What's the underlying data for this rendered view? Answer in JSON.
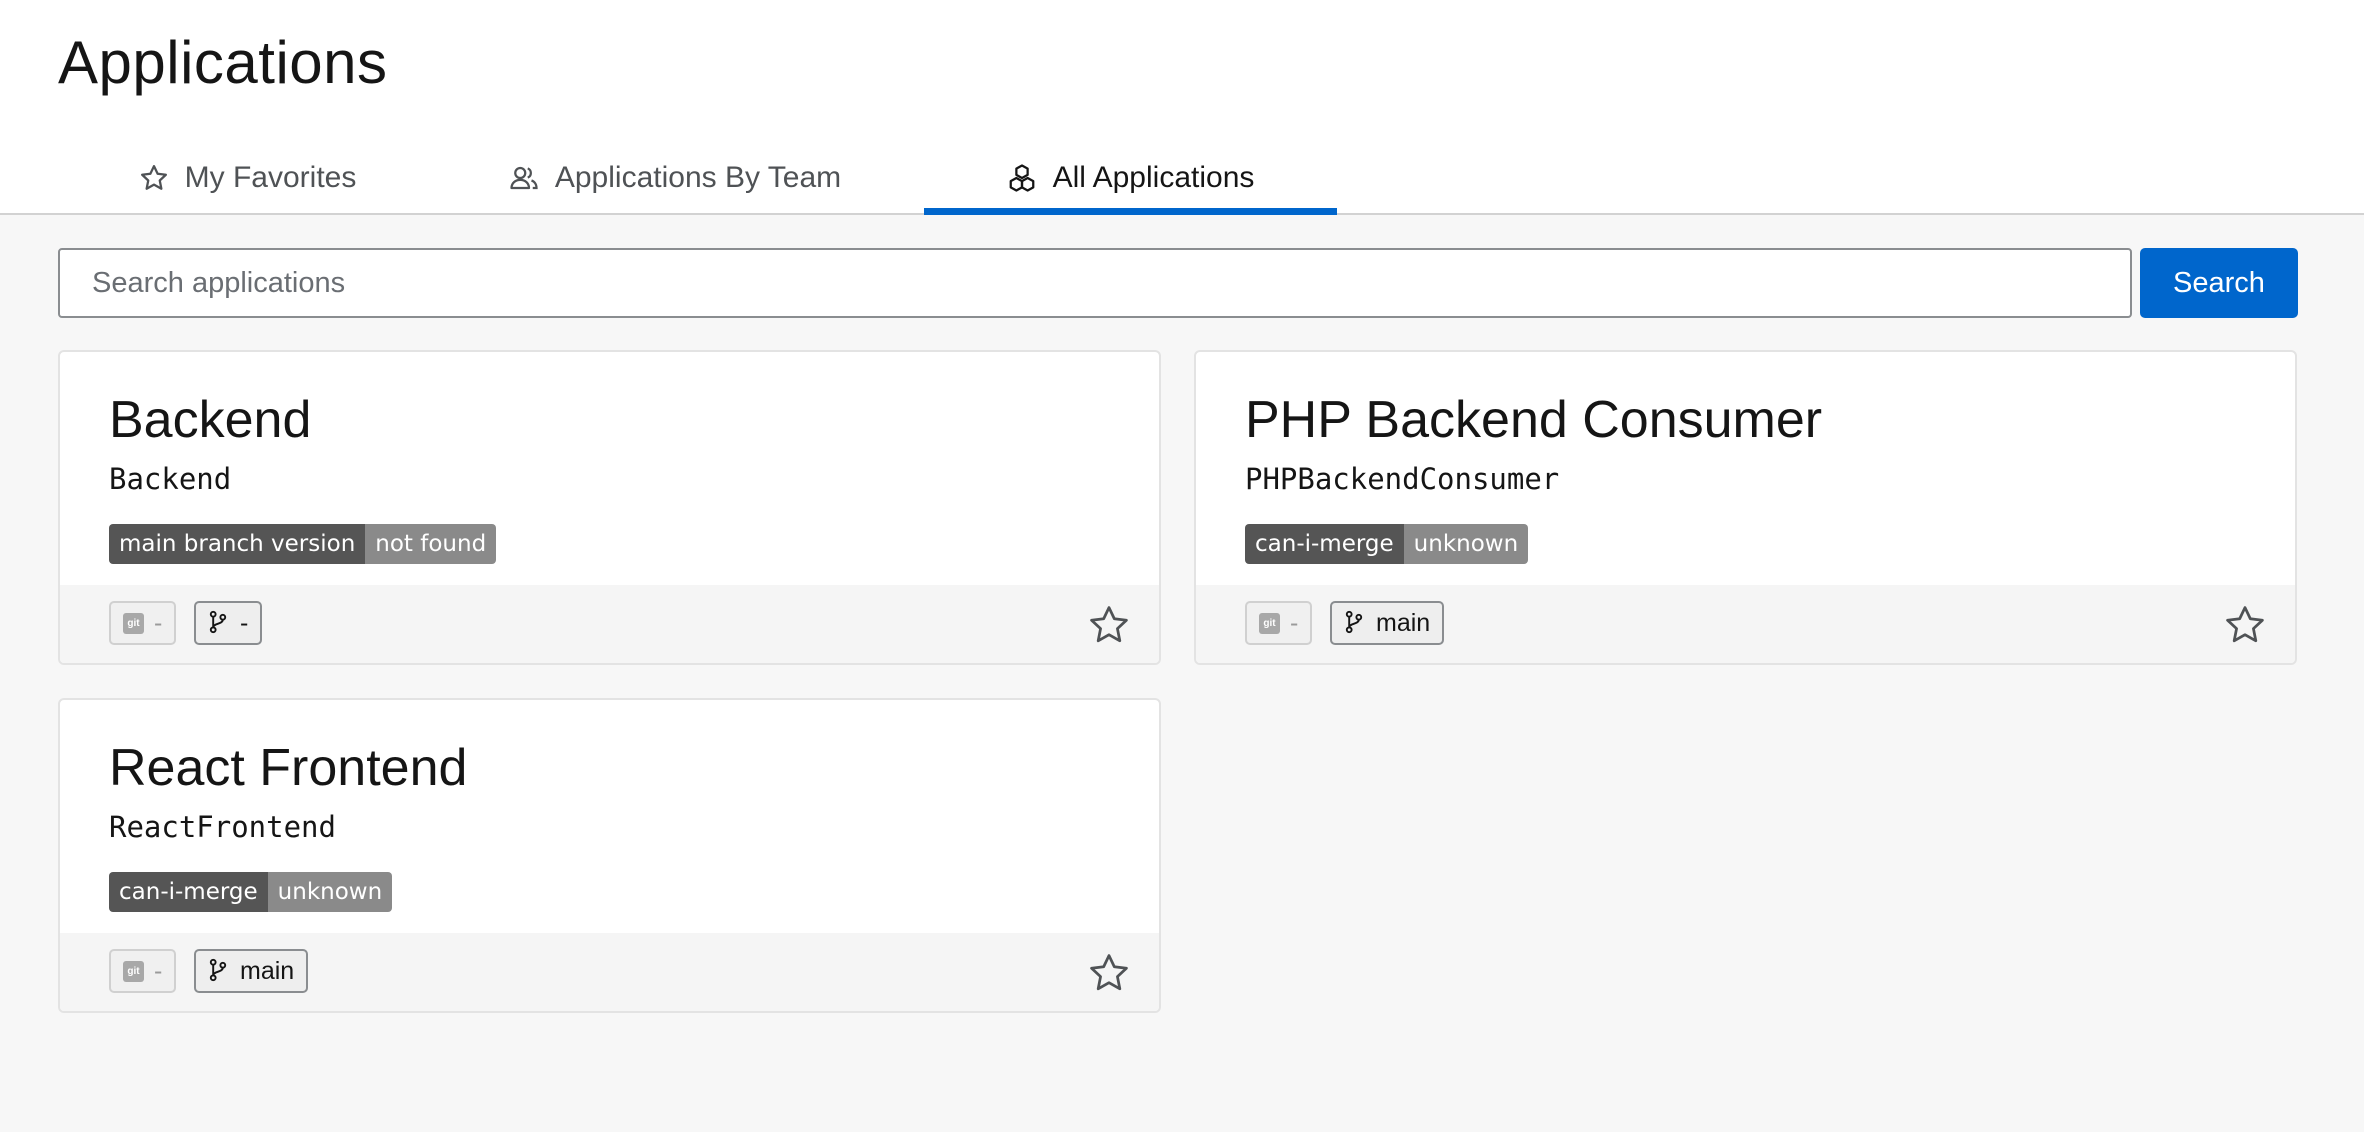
{
  "page": {
    "title": "Applications"
  },
  "tabs": [
    {
      "label": "My Favorites",
      "icon": "star-outline-icon"
    },
    {
      "label": "Applications By Team",
      "icon": "users-icon"
    },
    {
      "label": "All Applications",
      "icon": "cubes-icon",
      "active": true
    }
  ],
  "search": {
    "placeholder": "Search applications",
    "value": "",
    "button_label": "Search"
  },
  "colors": {
    "accent": "#0066cc",
    "badge_label": "#555555",
    "badge_value": "#8a8a8a"
  },
  "applications": [
    {
      "name": "Backend",
      "id": "Backend",
      "badge": {
        "label": "main branch version",
        "value": "not found"
      },
      "git_label": "git",
      "git_value": "-",
      "branch": "-",
      "favorite": false
    },
    {
      "name": "PHP Backend Consumer",
      "id": "PHPBackendConsumer",
      "badge": {
        "label": "can-i-merge",
        "value": "unknown"
      },
      "git_label": "git",
      "git_value": "-",
      "branch": "main",
      "favorite": false
    },
    {
      "name": "React Frontend",
      "id": "ReactFrontend",
      "badge": {
        "label": "can-i-merge",
        "value": "unknown"
      },
      "git_label": "git",
      "git_value": "-",
      "branch": "main",
      "favorite": false
    }
  ]
}
